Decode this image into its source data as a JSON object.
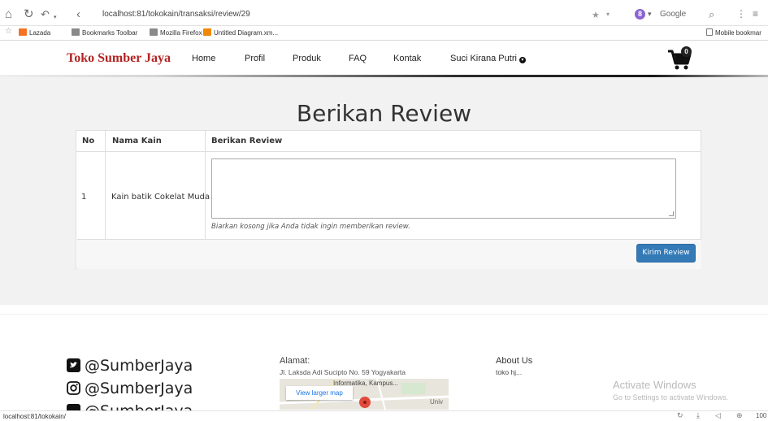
{
  "browser": {
    "url": "localhost:81/tokokain/transaksi/review/29",
    "search_engine": "Google",
    "engine_badge": "8",
    "bookmarks": [
      "Lazada",
      "Bookmarks Toolbar",
      "Mozilla Firefox",
      "Untitled Diagram.xm..."
    ],
    "mobile_bookmarks": "Mobile bookmar",
    "status_url": "localhost:81/tokokain/",
    "zoom": "100"
  },
  "navbar": {
    "brand": "Toko Sumber Jaya",
    "links": [
      "Home",
      "Profil",
      "Produk",
      "FAQ",
      "Kontak"
    ],
    "user": "Suci Kirana Putri",
    "cart_count": "0"
  },
  "review": {
    "title": "Berikan Review",
    "headers": [
      "No",
      "Nama Kain",
      "Berikan Review"
    ],
    "row": {
      "no": "1",
      "nama_kain": "Kain batik Cokelat Muda",
      "review_value": ""
    },
    "help_text": "Biarkan kosong jika Anda tidak ingin memberikan review.",
    "submit_label": "Kirim Review",
    "submit_color": "#337ab7"
  },
  "footer": {
    "socials": [
      "@SumberJaya",
      "@SumberJaya",
      "@SumberJaya"
    ],
    "address_label": "Alamat:",
    "address": "Jl. Laksda Adi Sucipto No. 59 Yogyakarta",
    "map_button": "View larger map",
    "map_labels": [
      "Informatika, Kampus...",
      "Univ"
    ],
    "about_label": "About Us",
    "about_text": "toko hj..."
  },
  "overlay": {
    "activate_title": "Activate Windows",
    "activate_sub": "Go to Settings to activate Windows."
  },
  "colors": {
    "brand": "#b22222",
    "primary": "#337ab7",
    "section_bg": "#f2f2f2"
  }
}
